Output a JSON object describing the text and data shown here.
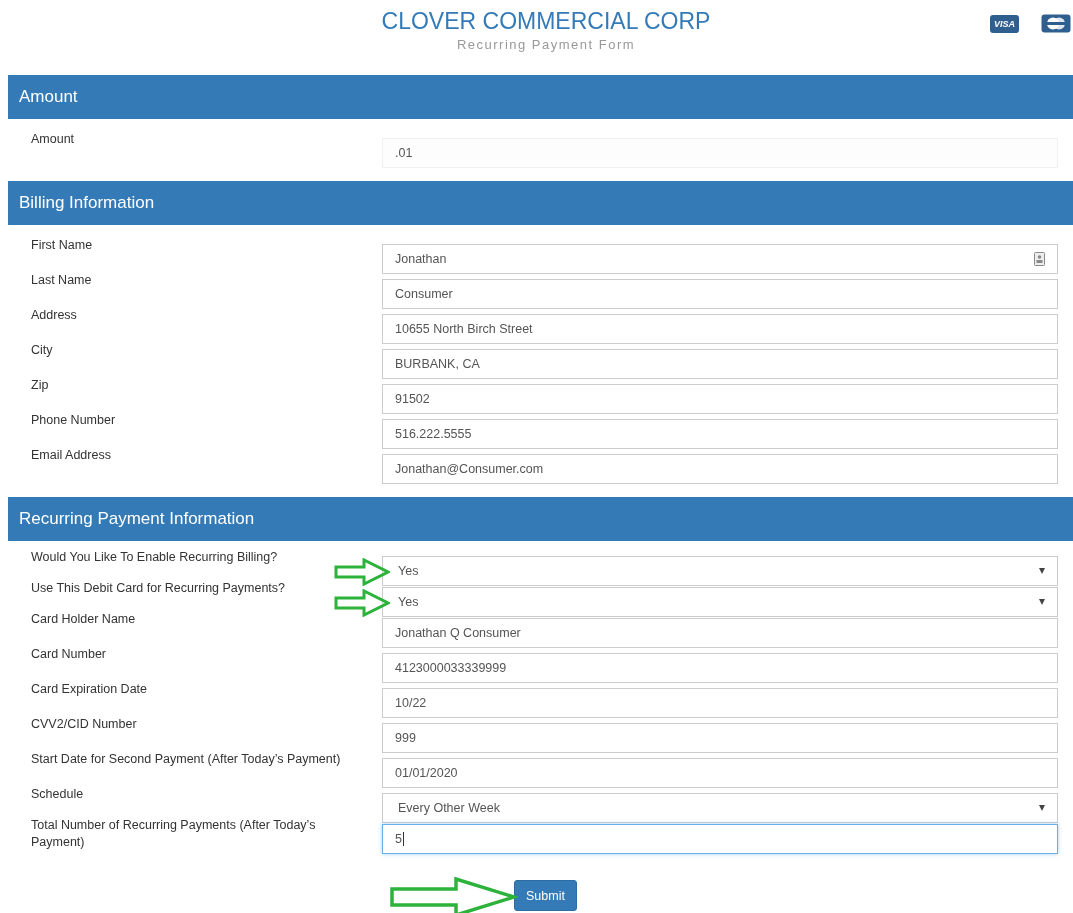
{
  "header": {
    "title": "CLOVER COMMERCIAL CORP",
    "subtitle": "Recurring Payment Form",
    "cards": [
      {
        "kind": "visa",
        "label": "VISA"
      },
      {
        "kind": "mastercard"
      }
    ]
  },
  "sections": [
    {
      "title": "Amount",
      "fields": [
        {
          "label": "Amount",
          "kind": "input",
          "value": ".01",
          "readonly": true
        }
      ]
    },
    {
      "title": "Billing Information",
      "fields": [
        {
          "label": "First Name",
          "kind": "input",
          "value": "Jonathan",
          "autofill_icon": true
        },
        {
          "label": "Last Name",
          "kind": "input",
          "value": "Consumer"
        },
        {
          "label": "Address",
          "kind": "input",
          "value": "10655 North Birch Street"
        },
        {
          "label": "City",
          "kind": "input",
          "value": "BURBANK, CA"
        },
        {
          "label": "Zip",
          "kind": "input",
          "value": "91502"
        },
        {
          "label": "Phone Number",
          "kind": "input",
          "value": "516.222.5555"
        },
        {
          "label": "Email Address",
          "kind": "input",
          "value": "Jonathan@Consumer.com"
        }
      ]
    },
    {
      "title": "Recurring Payment Information",
      "fields": [
        {
          "label": "Would You Like To Enable Recurring Billing?",
          "kind": "select",
          "value": "Yes",
          "pointed": true
        },
        {
          "label": "Use This Debit Card for Recurring Payments?",
          "kind": "select",
          "value": "Yes",
          "pointed": true
        },
        {
          "label": "Card Holder Name",
          "kind": "input",
          "value": "Jonathan Q Consumer"
        },
        {
          "label": "Card Number",
          "kind": "input",
          "value": "4123000033339999"
        },
        {
          "label": "Card Expiration Date",
          "kind": "input",
          "value": "10/22"
        },
        {
          "label": "CVV2/CID Number",
          "kind": "input",
          "value": "999"
        },
        {
          "label": "Start Date for Second Payment (After Today’s Payment)",
          "kind": "input",
          "value": "01/01/2020"
        },
        {
          "label": "Schedule",
          "kind": "select",
          "value": "Every Other Week"
        },
        {
          "label": "Total Number of Recurring Payments (After Today’s Payment)",
          "kind": "input",
          "value": "5",
          "focused": true
        }
      ]
    }
  ],
  "submit": {
    "label": "Submit",
    "pointed": true
  }
}
